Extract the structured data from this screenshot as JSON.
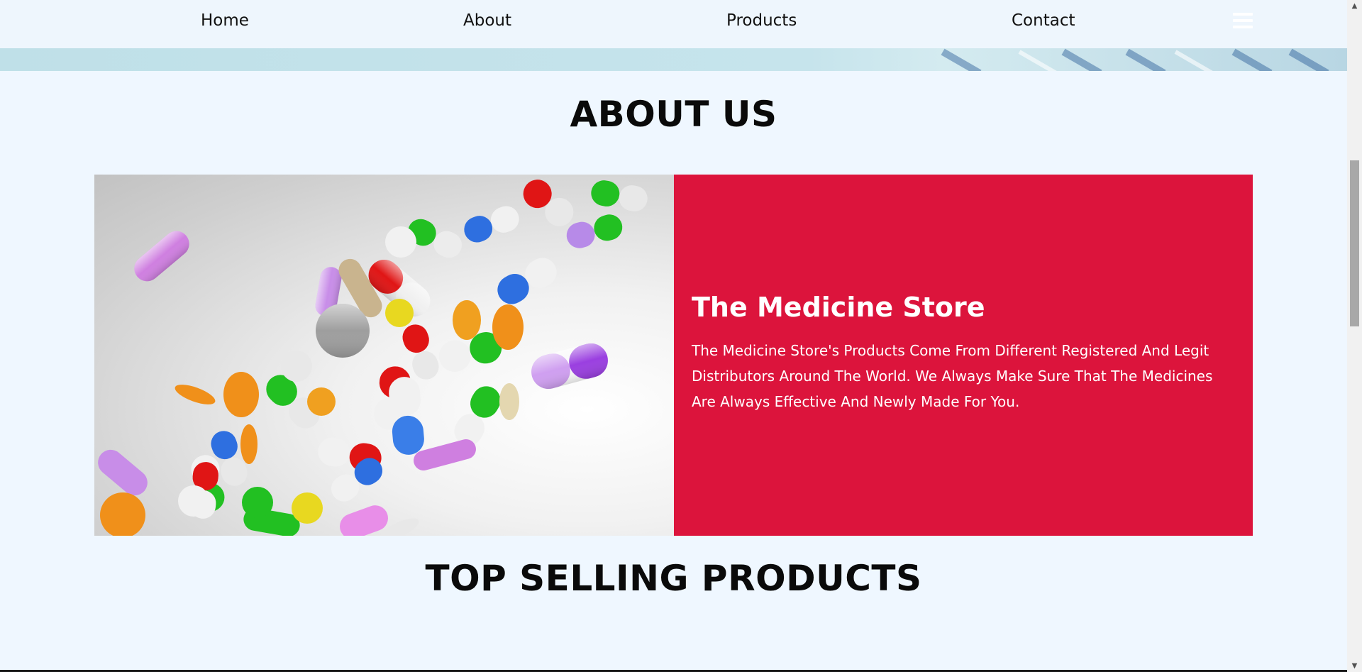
{
  "nav": {
    "items": [
      {
        "label": "Home"
      },
      {
        "label": "About"
      },
      {
        "label": "Products"
      },
      {
        "label": "Contact"
      }
    ],
    "menu_icon": "hamburger-menu-icon"
  },
  "about": {
    "title": "ABOUT US",
    "image_alt_icon": "pills-image",
    "panel": {
      "heading": "The Medicine Store",
      "text": "The Medicine Store's Products Come From Different Registered And Legit Distributors Around The World. We Always Make Sure That The Medicines Are Always Effective And Newly Made For You."
    }
  },
  "top_selling": {
    "title": "TOP SELLING PRODUCTS"
  },
  "colors": {
    "page_bg": "#eff7ff",
    "accent_panel": "#dc143c",
    "heading_text": "#0a0a0a"
  }
}
